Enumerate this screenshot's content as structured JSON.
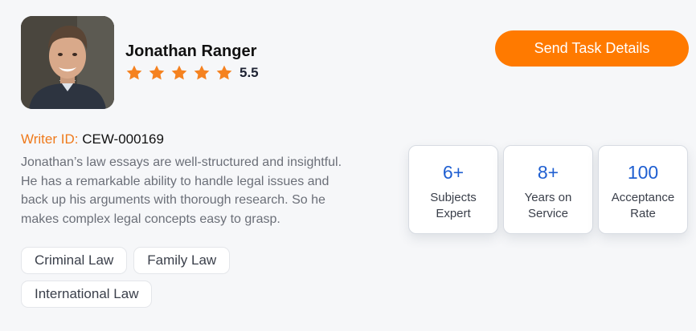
{
  "profile": {
    "name": "Jonathan Ranger",
    "rating": "5.5",
    "star_count": 5,
    "star_color": "#f58220",
    "avatar_icon": "person-photo"
  },
  "cta": {
    "label": "Send Task Details",
    "color": "#ff7a00"
  },
  "writer": {
    "id_label": "Writer ID:",
    "id_value": "CEW-000169"
  },
  "bio": "Jonathan’s law essays are well-structured and insightful. He has a remarkable ability to handle legal issues and back up his arguments with thorough research. So he makes complex legal concepts easy to grasp.",
  "tags": [
    "Criminal Law",
    "Family Law",
    "International Law"
  ],
  "stats": [
    {
      "value": "6+",
      "label_line1": "Subjects",
      "label_line2": "Expert"
    },
    {
      "value": "8+",
      "label_line1": "Years on",
      "label_line2": "Service"
    },
    {
      "value": "100",
      "label_line1": "Acceptance",
      "label_line2": "Rate"
    }
  ],
  "colors": {
    "accent_orange": "#ef7a1c",
    "stat_blue": "#1f5fd1"
  }
}
